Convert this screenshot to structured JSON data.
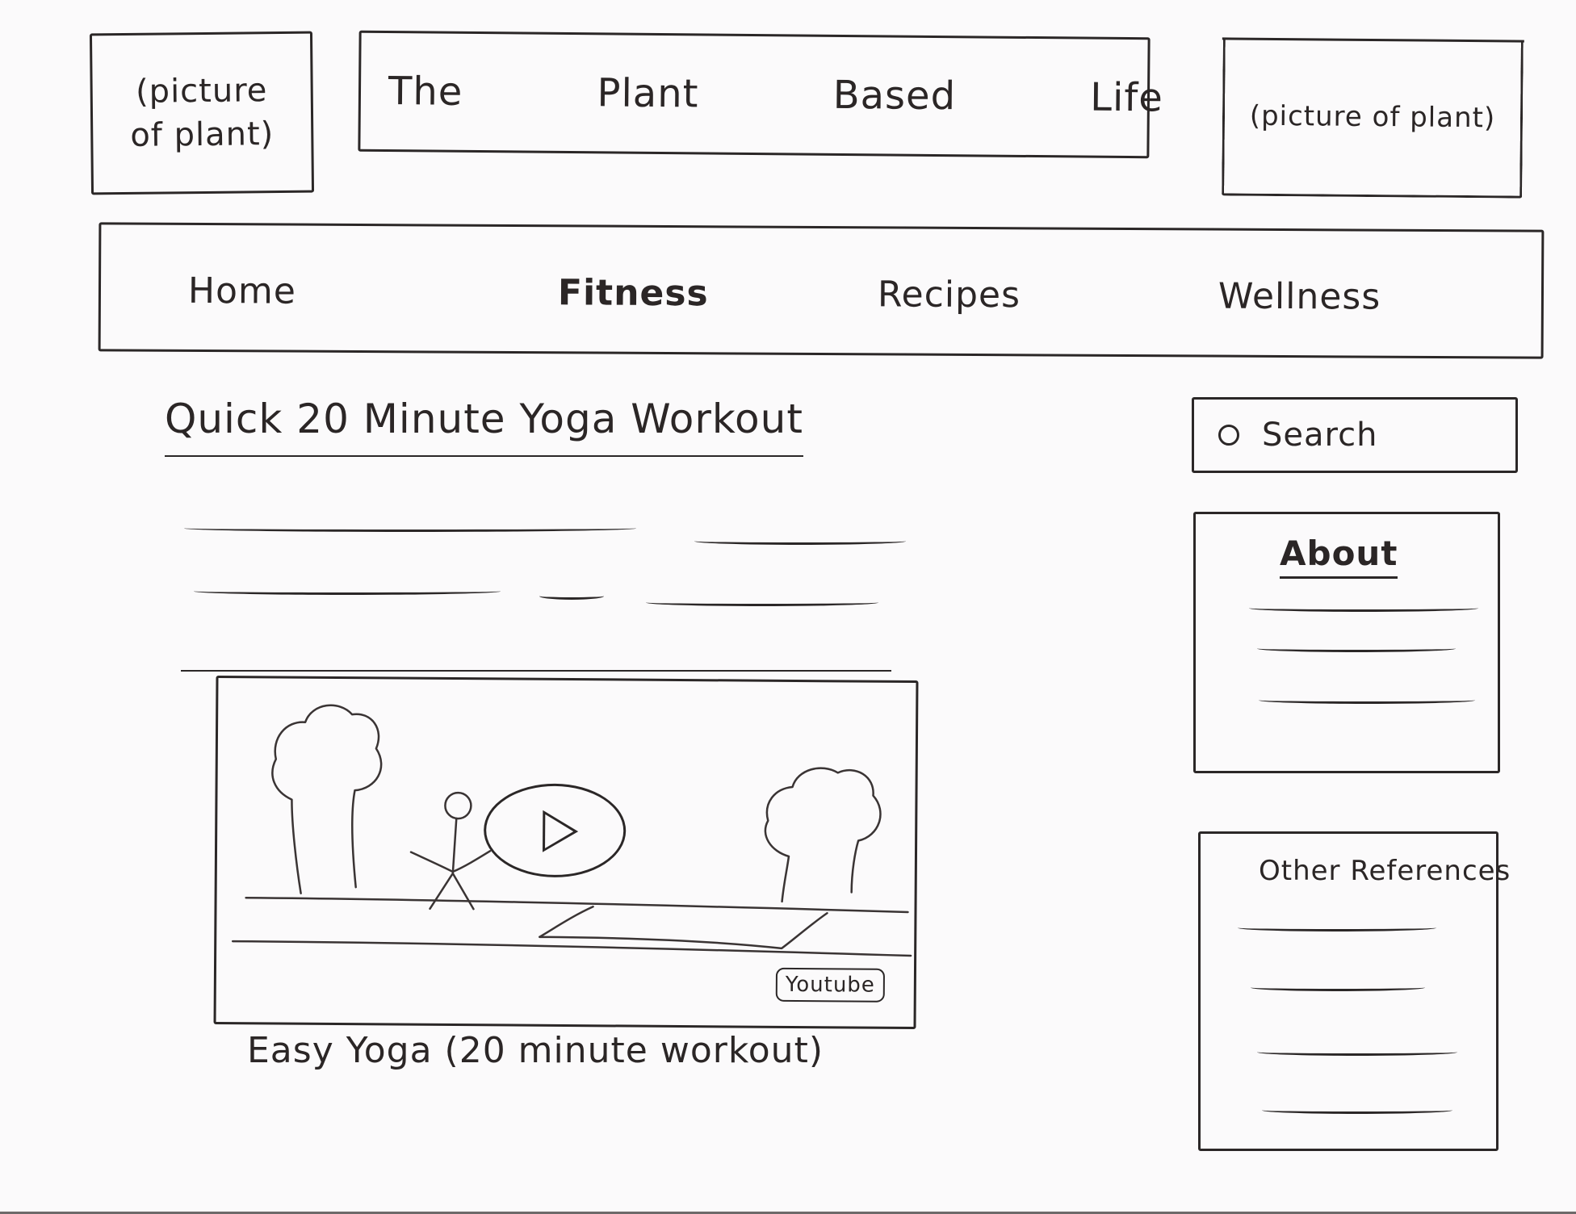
{
  "header": {
    "logo_left_text": "(picture of plant)",
    "site_title": "The Plant Based Life",
    "logo_right_text": "(picture of plant)"
  },
  "nav": {
    "items": [
      {
        "label": "Home"
      },
      {
        "label": "Fitness"
      },
      {
        "label": "Recipes"
      },
      {
        "label": "Wellness"
      }
    ],
    "active": "Fitness"
  },
  "main": {
    "article_title": "Quick 20 Minute Yoga Workout",
    "video": {
      "badge": "Youtube",
      "caption": "Easy Yoga (20 minute workout)"
    }
  },
  "sidebar": {
    "search_placeholder": "Search",
    "about_title": "About",
    "refs_title": "Other References"
  }
}
